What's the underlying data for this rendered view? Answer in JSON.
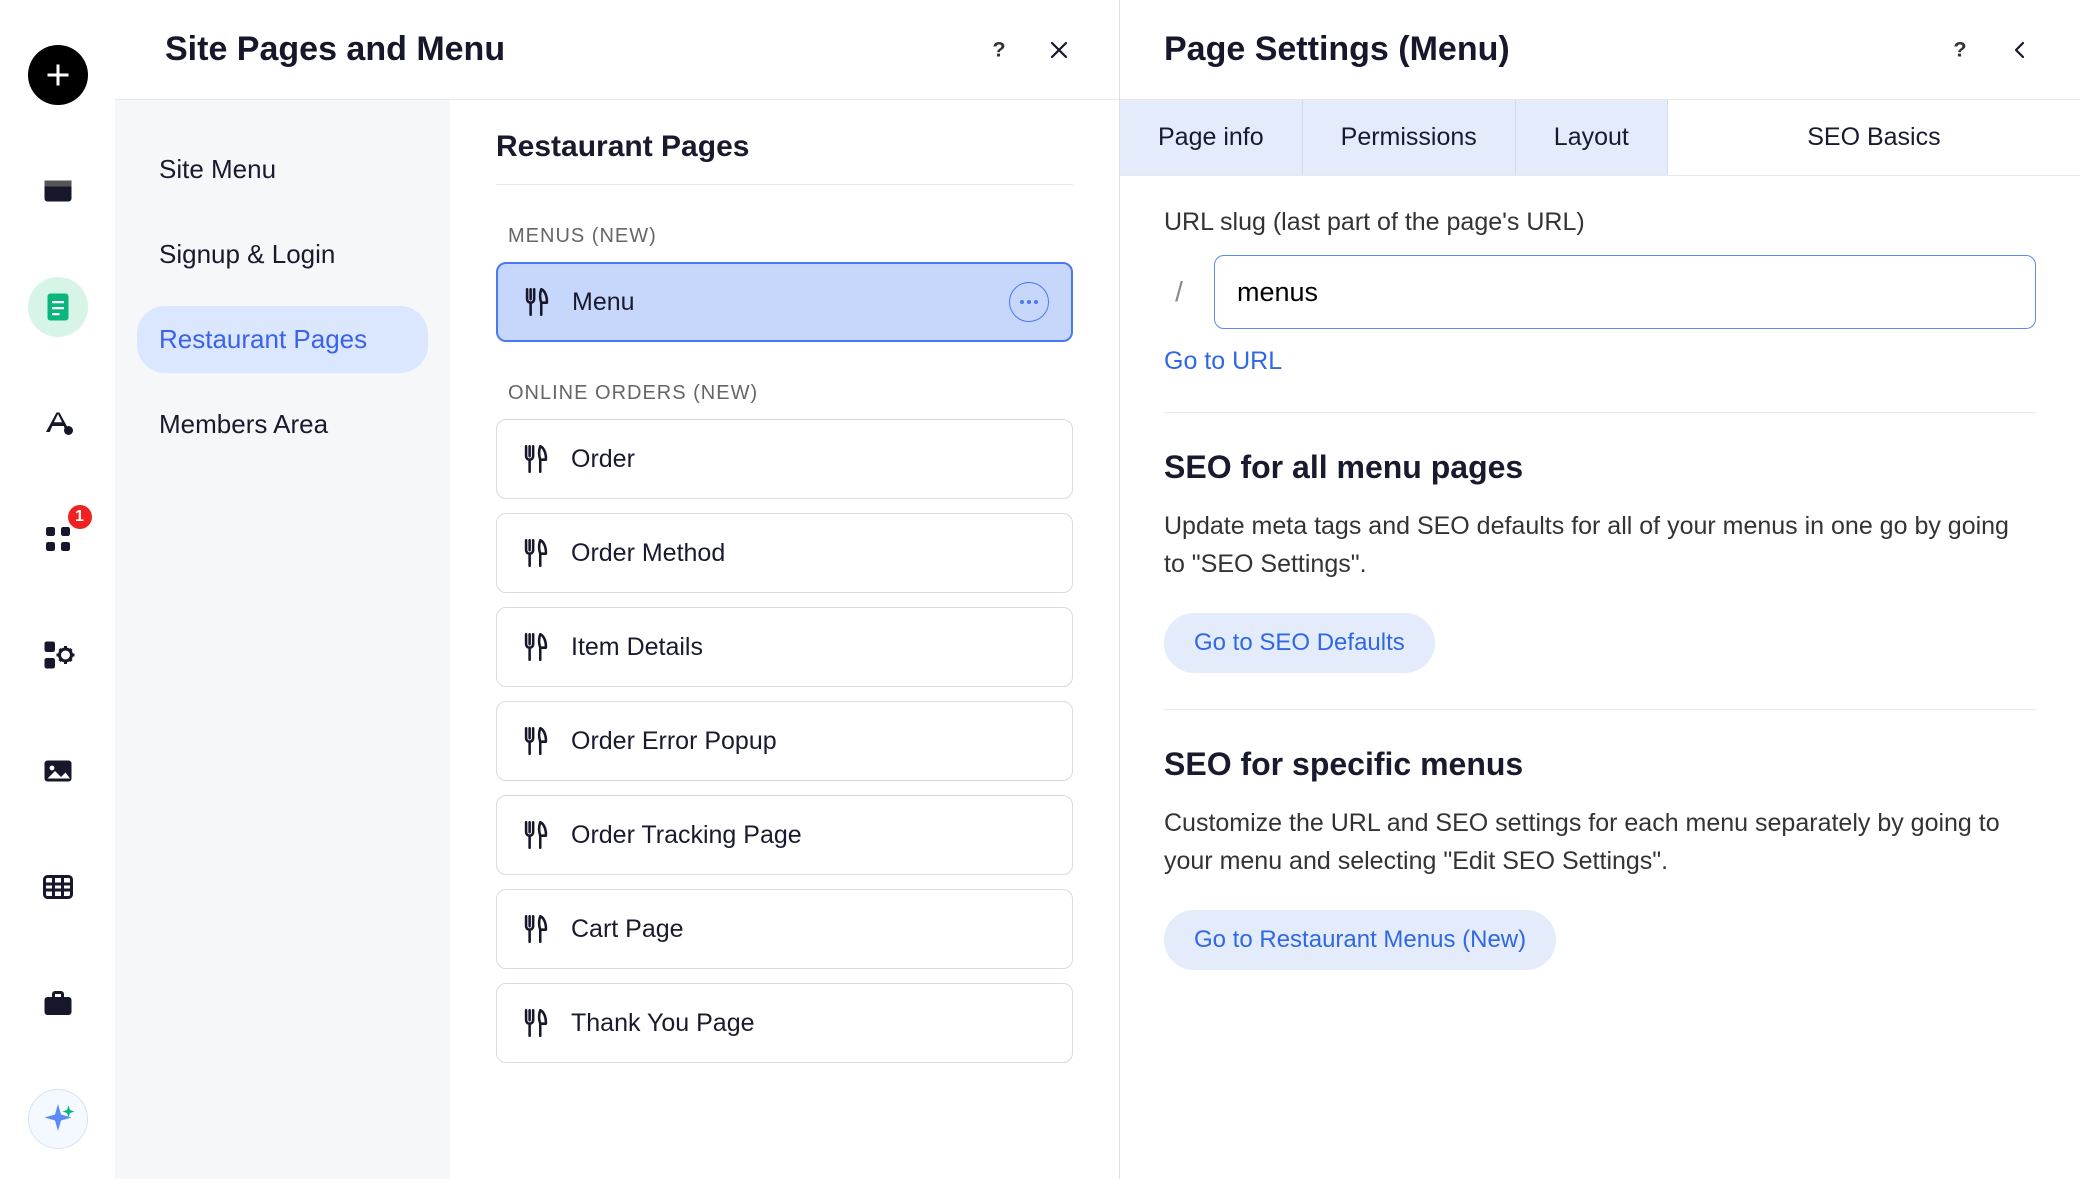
{
  "rail": {
    "badge_count": "1"
  },
  "panel1": {
    "title": "Site Pages and Menu",
    "nav": [
      {
        "label": "Site Menu",
        "active": false
      },
      {
        "label": "Signup & Login",
        "active": false
      },
      {
        "label": "Restaurant Pages",
        "active": true
      },
      {
        "label": "Members Area",
        "active": false
      }
    ],
    "midTitle": "Restaurant Pages",
    "group1Label": "MENUS (NEW)",
    "group1": [
      {
        "label": "Menu",
        "selected": true
      }
    ],
    "group2Label": "ONLINE ORDERS (NEW)",
    "group2": [
      {
        "label": "Order"
      },
      {
        "label": "Order Method"
      },
      {
        "label": "Item Details"
      },
      {
        "label": "Order Error Popup"
      },
      {
        "label": "Order Tracking Page"
      },
      {
        "label": "Cart Page"
      },
      {
        "label": "Thank You Page"
      }
    ]
  },
  "panel2": {
    "title": "Page Settings (Menu)",
    "tabs": [
      {
        "label": "Page info",
        "active": false
      },
      {
        "label": "Permissions",
        "active": false
      },
      {
        "label": "Layout",
        "active": false
      },
      {
        "label": "SEO Basics",
        "active": true
      }
    ],
    "slugLabel": "URL slug (last part of the page's URL)",
    "slugSlash": "/",
    "slugValue": "menus",
    "goToUrl": "Go to URL",
    "sec1Title": "SEO for all menu pages",
    "sec1Body": "Update meta tags and SEO defaults for all of your menus in one go by going to \"SEO Settings\".",
    "sec1Btn": "Go to SEO Defaults",
    "sec2Title": "SEO for specific menus",
    "sec2Body": "Customize the URL and SEO settings for each menu separately by going to your menu and selecting \"Edit SEO Settings\".",
    "sec2Btn": "Go to Restaurant Menus (New)"
  }
}
